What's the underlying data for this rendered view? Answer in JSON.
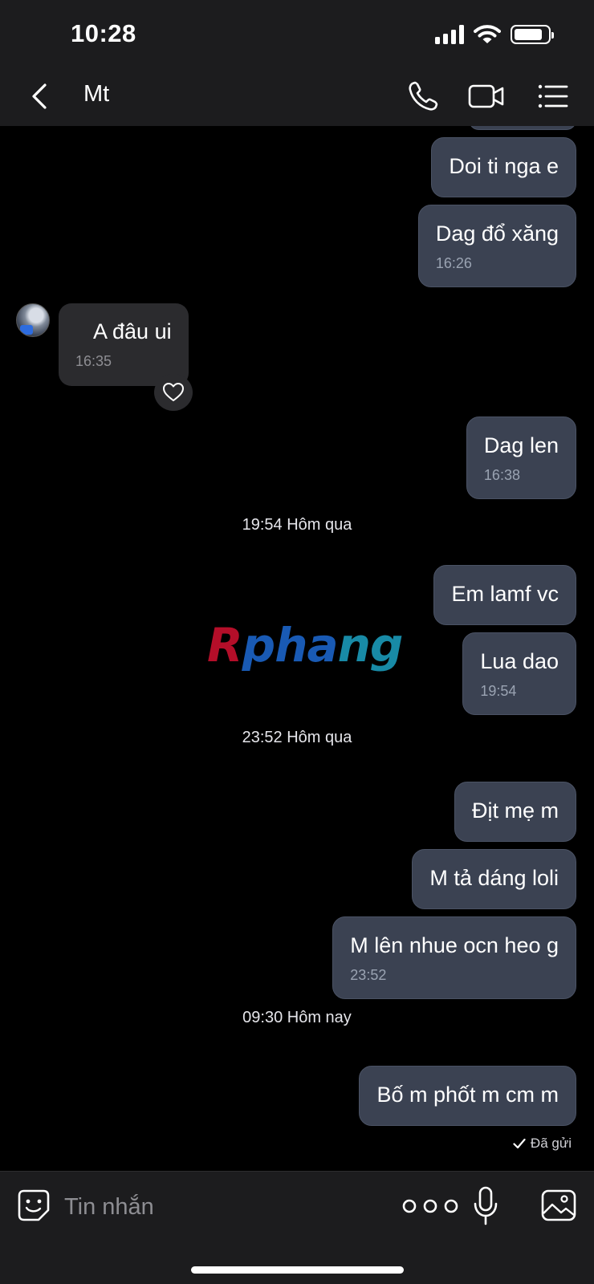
{
  "status_bar": {
    "time": "10:28",
    "battery_level": 0.85
  },
  "header": {
    "contact_name": "Mt",
    "icons": [
      "chevron-left-icon",
      "phone-icon",
      "video-camera-icon",
      "list-menu-icon"
    ]
  },
  "messages": [
    {
      "dir": "out",
      "text": "Doi ti nga e"
    },
    {
      "dir": "out",
      "text": "Dag đổ xăng",
      "time": "16:26"
    },
    {
      "dir": "in",
      "text": "A đâu ui",
      "time": "16:35"
    },
    {
      "dir": "out",
      "text": "Dag len",
      "time": "16:38"
    },
    {
      "dir": "out",
      "text": "Em lamf vc"
    },
    {
      "dir": "out",
      "text": "Lua dao",
      "time": "19:54"
    },
    {
      "dir": "out",
      "text": "Địt mẹ m"
    },
    {
      "dir": "out",
      "text": "M tả dáng loli"
    },
    {
      "dir": "out",
      "text": "M lên nhue ocn heo g",
      "time": "23:52"
    },
    {
      "dir": "out",
      "text": "Bố m phốt m cm m"
    }
  ],
  "separators": [
    "19:54 Hôm qua",
    "23:52 Hôm qua",
    "09:30 Hôm nay"
  ],
  "sent_status": "Đã gửi",
  "watermark": {
    "part1": "R",
    "part2": "pha",
    "part3": "ng"
  },
  "composer": {
    "placeholder": "Tin nhắn"
  },
  "colors": {
    "outgoing_bubble": "#3b4252",
    "incoming_bubble": "#2b2b2e",
    "header_bg": "#1c1c1e"
  }
}
